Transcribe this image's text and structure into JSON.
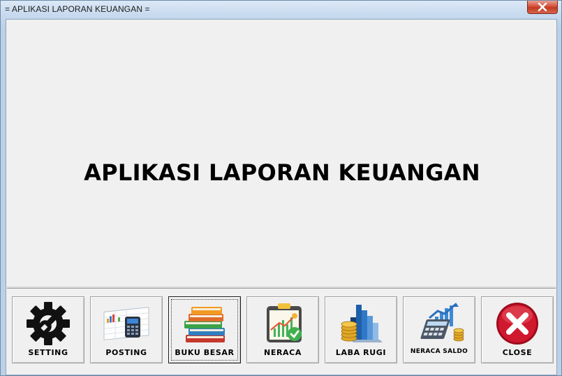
{
  "window": {
    "title": "=  APLIKASI LAPORAN KEUANGAN   ="
  },
  "main": {
    "heading": "APLIKASI LAPORAN KEUANGAN"
  },
  "toolbar": {
    "buttons": [
      {
        "label": "SETTING",
        "icon": "gear-wrench-icon"
      },
      {
        "label": "POSTING",
        "icon": "calculator-sheet-icon"
      },
      {
        "label": "BUKU BESAR",
        "icon": "books-icon"
      },
      {
        "label": "NERACA",
        "icon": "chart-clipboard-icon"
      },
      {
        "label": "LABA RUGI",
        "icon": "bar-chart-coins-icon"
      },
      {
        "label": "NERACA SALDO",
        "icon": "calculator-coins-icon"
      },
      {
        "label": "CLOSE",
        "icon": "close-icon"
      }
    ]
  },
  "colors": {
    "window_bg": "#f0f0f0",
    "close_red": "#c8102e"
  }
}
